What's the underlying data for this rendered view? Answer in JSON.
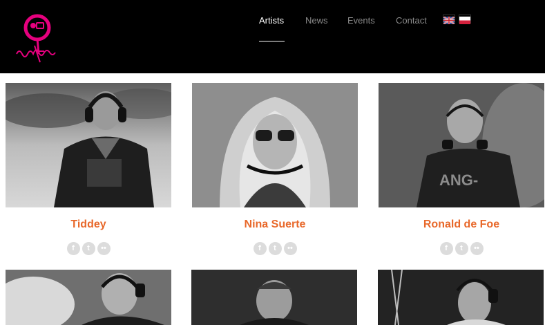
{
  "brand": {
    "name": "summAntlli",
    "accent": "#e6007e"
  },
  "nav": {
    "items": [
      {
        "label": "Artists",
        "active": true
      },
      {
        "label": "News",
        "active": false
      },
      {
        "label": "Events",
        "active": false
      },
      {
        "label": "Contact",
        "active": false
      }
    ],
    "languages": [
      "English",
      "Polski"
    ]
  },
  "artists": [
    {
      "name": "Tiddey",
      "socials": [
        "facebook-icon",
        "twitter-icon",
        "flickr-icon"
      ]
    },
    {
      "name": "Nina Suerte",
      "socials": [
        "facebook-icon",
        "twitter-icon",
        "flickr-icon"
      ]
    },
    {
      "name": "Ronald de Foe",
      "socials": [
        "facebook-icon",
        "twitter-icon",
        "flickr-icon"
      ]
    },
    {
      "name": "",
      "socials": []
    },
    {
      "name": "",
      "socials": []
    },
    {
      "name": "",
      "socials": []
    }
  ],
  "colors": {
    "name_color": "#e8682a",
    "header_bg": "#000000",
    "social_bg": "#dcdcdc"
  }
}
